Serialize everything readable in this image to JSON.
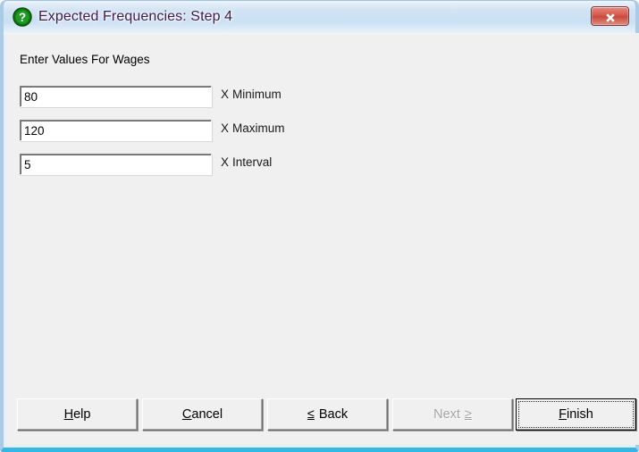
{
  "window": {
    "title": "Expected Frequencies: Step 4",
    "icon": "question-mark-icon",
    "close_label": "x",
    "frame_color": "#a8cbe8",
    "title_text_color": "#3b1a52",
    "client_background": "#f0f0f0",
    "bottom_border_color": "#35b6e4"
  },
  "main": {
    "instruction": "Enter Values For Wages",
    "fields": [
      {
        "value": "80",
        "placeholder": "",
        "label_variable": "X",
        "label_text": "Minimum",
        "name": "x-minimum"
      },
      {
        "value": "120",
        "placeholder": "",
        "label_variable": "X",
        "label_text": "Maximum",
        "name": "x-maximum"
      },
      {
        "value": "5",
        "placeholder": "",
        "label_variable": "X",
        "label_text": "Interval",
        "name": "x-interval"
      }
    ]
  },
  "buttons": {
    "help": {
      "mnemonic": "H",
      "rest": "elp"
    },
    "cancel": {
      "mnemonic": "C",
      "rest": "ancel"
    },
    "back": {
      "symbol": "≤",
      "text": "Back"
    },
    "next": {
      "text": "Next",
      "symbol": "≥",
      "state": "disabled"
    },
    "finish": {
      "mnemonic": "F",
      "rest": "inish",
      "state": "default-focused"
    }
  }
}
